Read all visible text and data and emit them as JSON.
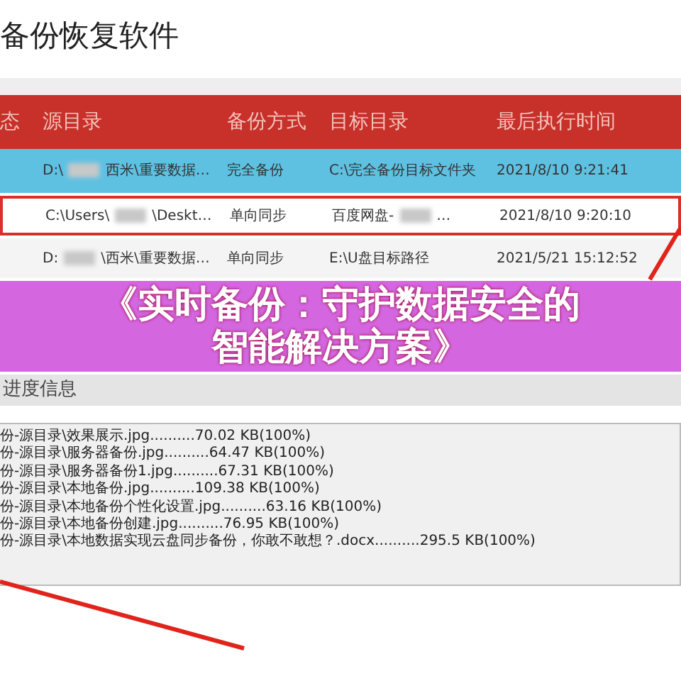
{
  "window": {
    "title": "备份恢复软件"
  },
  "table": {
    "columns": [
      "态",
      "源目录",
      "备份方式",
      "目标目录",
      "最后执行时间"
    ],
    "rows": [
      {
        "selected": true,
        "outlined": false,
        "source": [
          "D:\\",
          "西米\\重要数据…"
        ],
        "mode": "完全备份",
        "target": [
          "C:\\完全备份目标文件夹"
        ],
        "time": "2021/8/10 9:21:41"
      },
      {
        "selected": false,
        "outlined": true,
        "source": [
          "C:\\Users\\",
          "\\Deskt…"
        ],
        "mode": "单向同步",
        "target": [
          "百度网盘-",
          "…"
        ],
        "time": "2021/8/10 9:20:10"
      },
      {
        "selected": false,
        "outlined": false,
        "source": [
          "D:",
          "\\西米\\重要数据…"
        ],
        "mode": "单向同步",
        "target": [
          "E:\\U盘目标路径"
        ],
        "time": "2021/5/21 15:12:52"
      }
    ]
  },
  "progress_panel": {
    "heading": "进度信息",
    "log": [
      "份-源目录\\效果展示.jpg..........70.02 KB(100%)",
      "份-源目录\\服务器备份.jpg..........64.47 KB(100%)",
      "份-源目录\\服务器备份1.jpg..........67.31 KB(100%)",
      "份-源目录\\本地备份.jpg..........109.38 KB(100%)",
      "份-源目录\\本地备份个性化设置.jpg..........63.16 KB(100%)",
      "份-源目录\\本地备份创建.jpg..........76.95 KB(100%)",
      "份-源目录\\本地数据实现云盘同步备份，你敢不敢想？.docx..........295.5 KB(100%)"
    ]
  },
  "banner": {
    "lines": [
      "《实时备份：守护数据安全的",
      "智能解决方案》"
    ]
  }
}
